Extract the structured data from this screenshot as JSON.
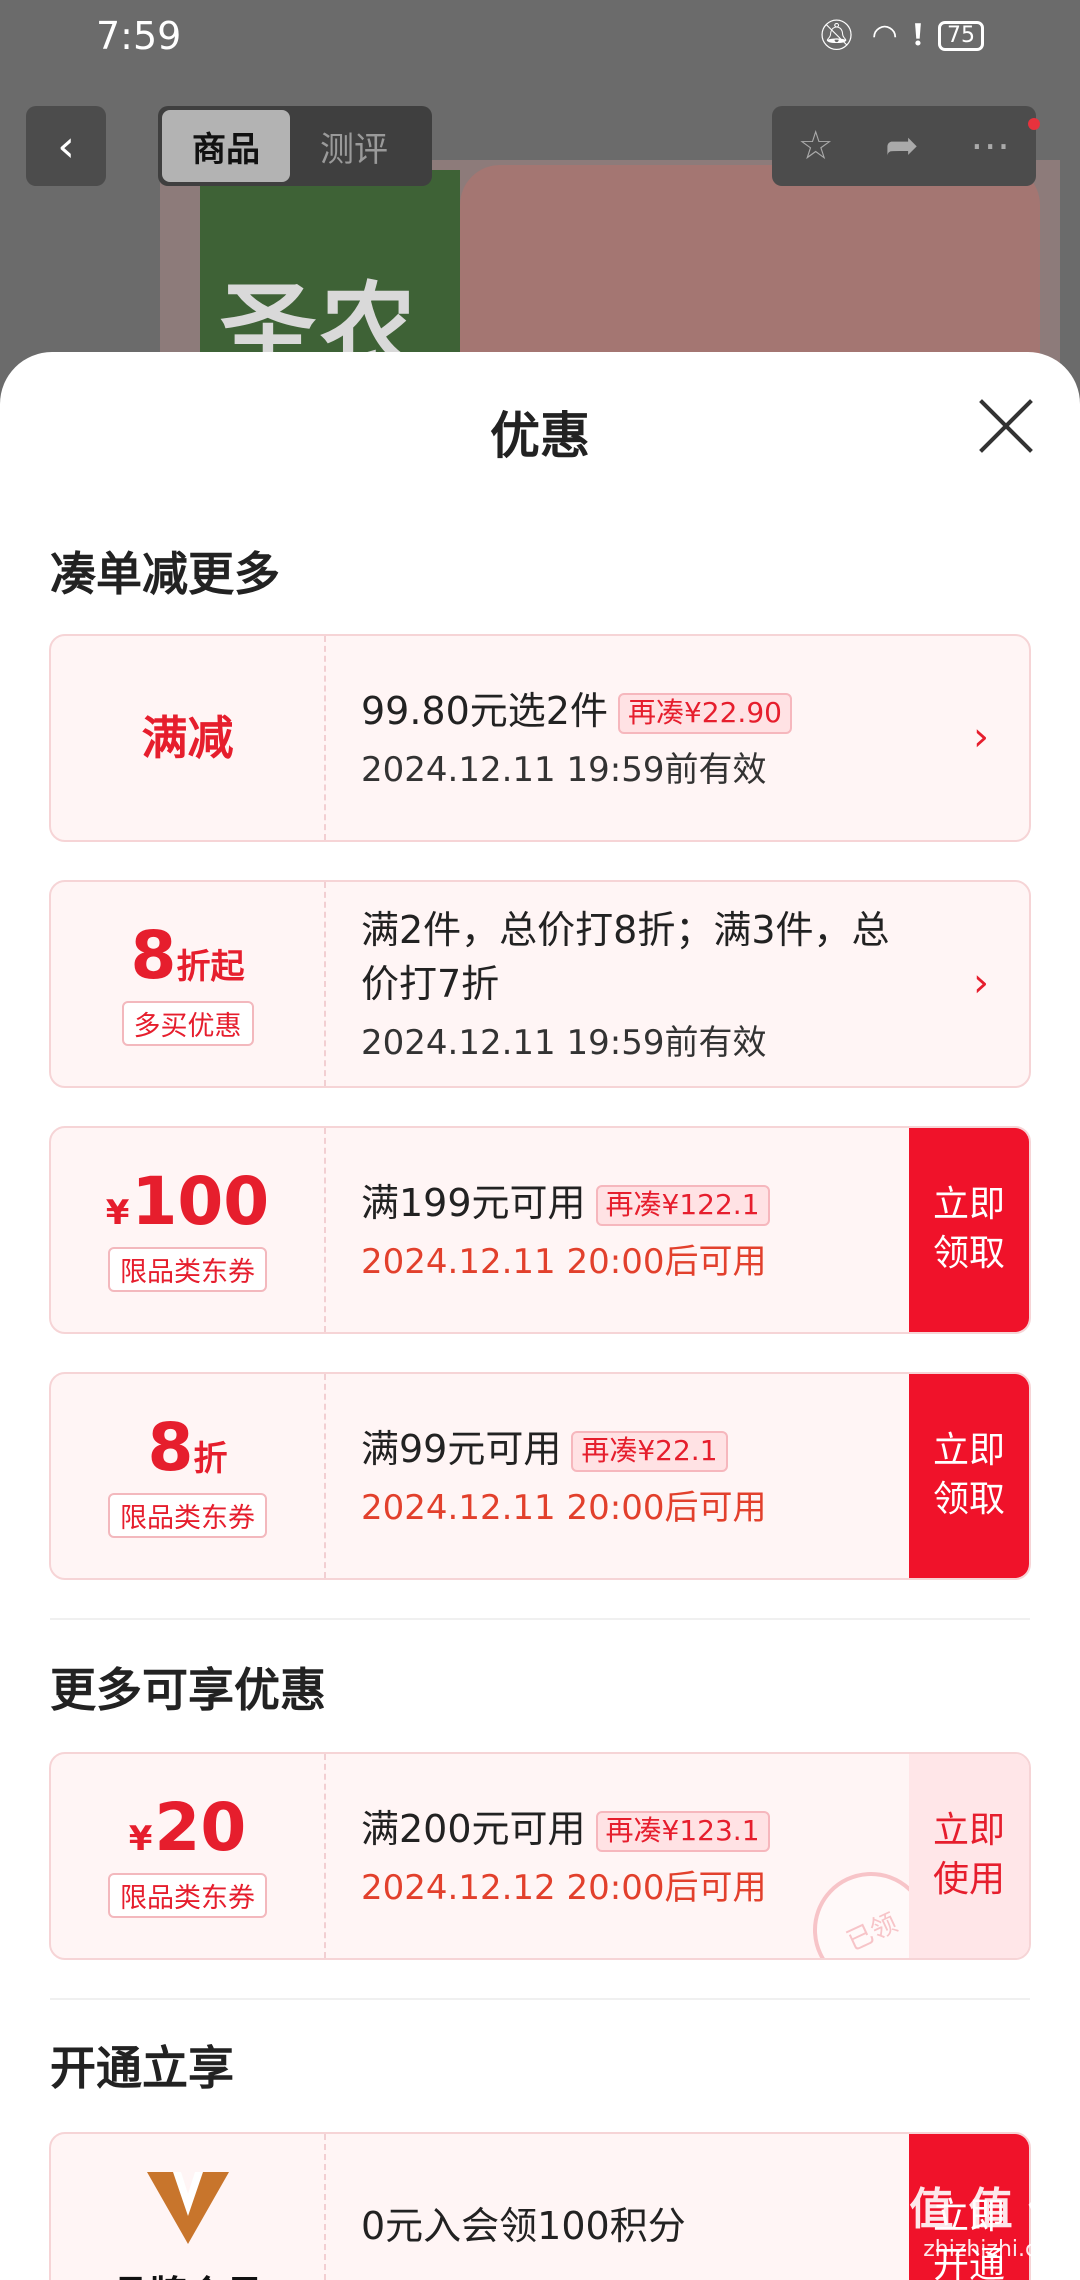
{
  "status_bar": {
    "time": "7:59",
    "battery": "75"
  },
  "product_page": {
    "tabs": [
      {
        "label": "商品"
      },
      {
        "label": "测评"
      }
    ],
    "image_brand_text": "圣农"
  },
  "sheet": {
    "title": "优惠",
    "sections": {
      "bundle": "凑单减更多",
      "more": "更多可享优惠",
      "membership": "开通立享"
    },
    "coupons": [
      {
        "left_title": "满减",
        "main": "99.80元选2件",
        "pill": "再凑¥22.90",
        "date": "2024.12.11 19:59前有效"
      },
      {
        "left_amount": "8",
        "left_suffix": "折起",
        "left_tag": "多买优惠",
        "main": "满2件，总价打8折；满3件，总价打7折",
        "date": "2024.12.11 19:59前有效"
      },
      {
        "left_yen": "¥",
        "left_amount": "100",
        "left_tag": "限品类东券",
        "main": "满199元可用",
        "pill": "再凑¥122.1",
        "date": "2024.12.11 20:00后可用",
        "action_line1": "立即",
        "action_line2": "领取"
      },
      {
        "left_amount": "8",
        "left_suffix": "折",
        "left_tag": "限品类东券",
        "main": "满99元可用",
        "pill": "再凑¥22.1",
        "date": "2024.12.11 20:00后可用",
        "action_line1": "立即",
        "action_line2": "领取"
      },
      {
        "left_yen": "¥",
        "left_amount": "20",
        "left_tag": "限品类东券",
        "main": "满200元可用",
        "pill": "再凑¥123.1",
        "date": "2024.12.12 20:00后可用",
        "action_line1": "立即",
        "action_line2": "使用",
        "stamp": "已领"
      },
      {
        "left_name": "品牌会员",
        "main": "0元入会领100积分",
        "action_line1": "立即",
        "action_line2": "开通"
      }
    ]
  },
  "watermark": {
    "text": "值 值 值",
    "sub": "zhizhizhi.com"
  },
  "colors": {
    "accent": "#f0122a",
    "coupon_bg": "#fff5f5",
    "text_red": "#e61e2d"
  }
}
